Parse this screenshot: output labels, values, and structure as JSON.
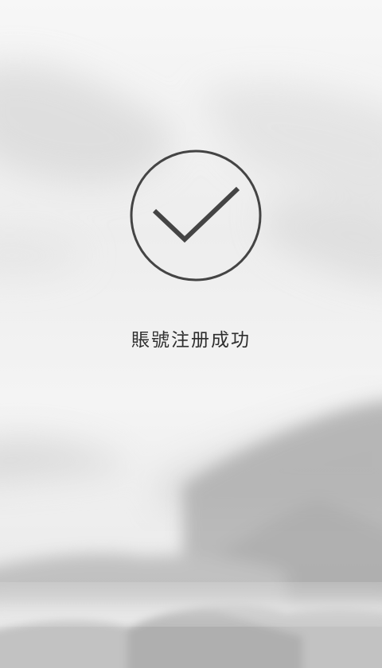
{
  "registration": {
    "status_icon": "check-circle-icon",
    "message": "賬號注册成功"
  },
  "theme": {
    "icon_color": "#444444",
    "text_color": "#2e2e2e",
    "background": "#f2f2f2"
  }
}
